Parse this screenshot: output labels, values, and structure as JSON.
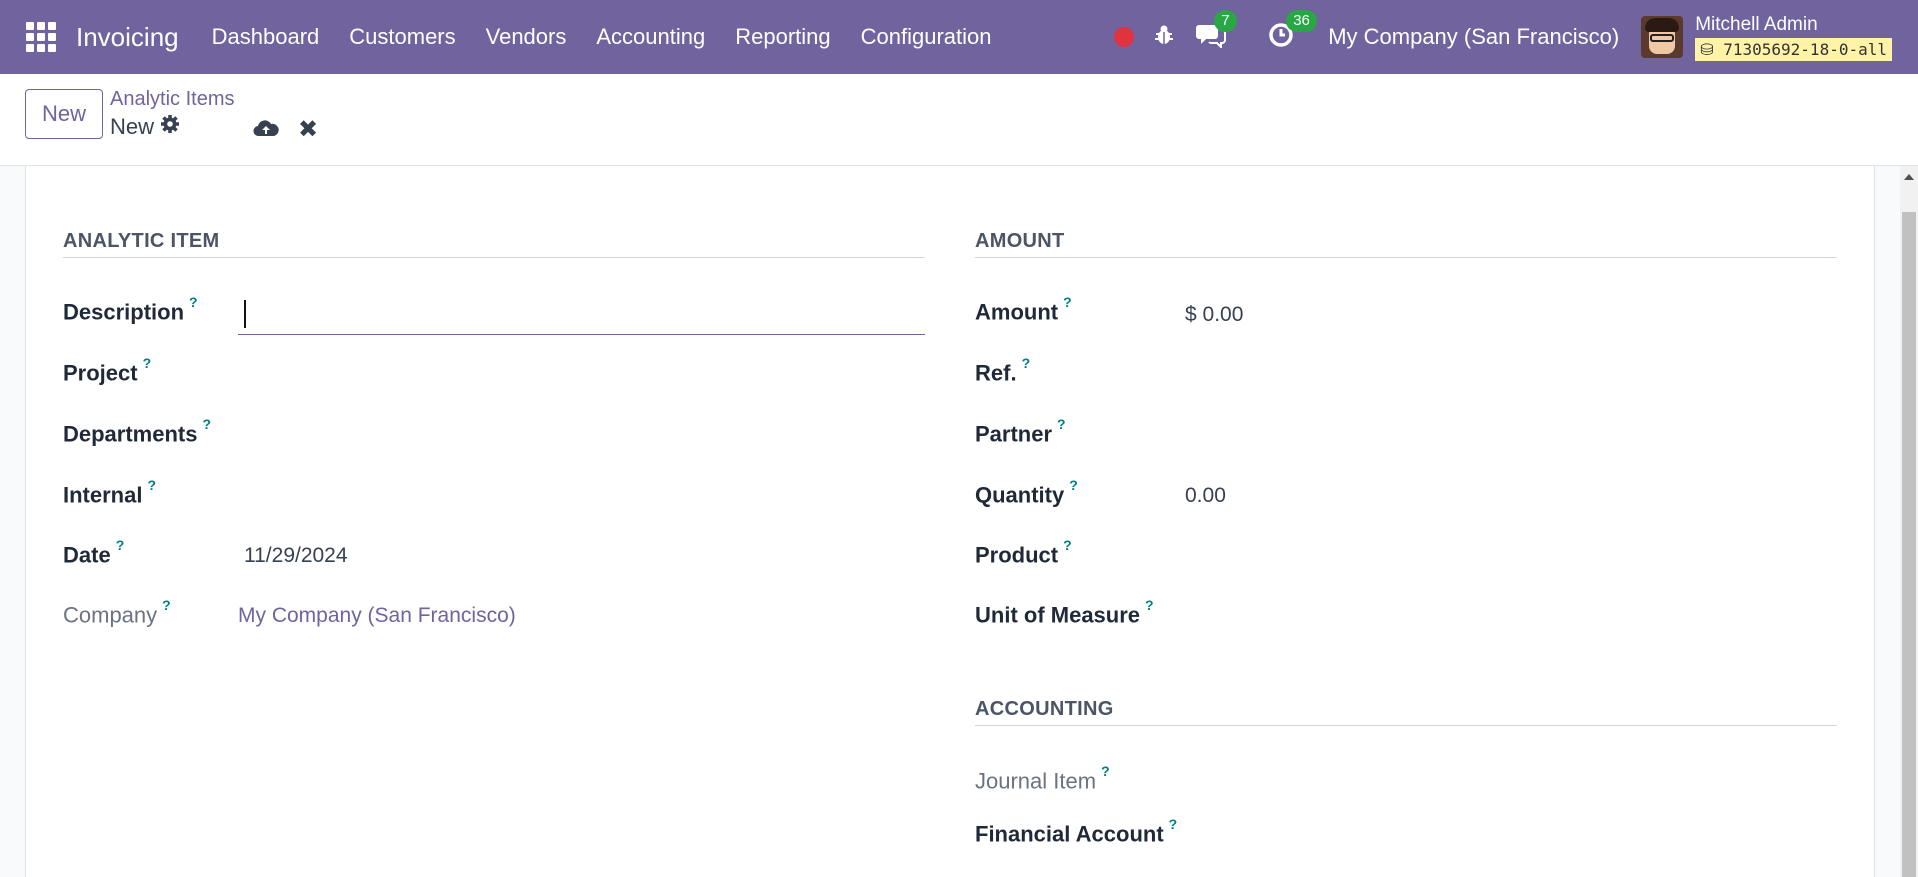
{
  "navbar": {
    "app_title": "Invoicing",
    "menu": [
      "Dashboard",
      "Customers",
      "Vendors",
      "Accounting",
      "Reporting",
      "Configuration"
    ],
    "chat_count": "7",
    "activity_count": "36",
    "company": "My Company (San Francisco)",
    "user_name": "Mitchell Admin",
    "database": "71305692-18-0-all",
    "accent_color": "#71639e"
  },
  "control": {
    "new_label": "New",
    "breadcrumb": "Analytic Items",
    "record_name": "New"
  },
  "form": {
    "left_section_title": "ANALYTIC ITEM",
    "right_section_title": "AMOUNT",
    "accounting_section_title": "ACCOUNTING",
    "help_marker": "?",
    "left_fields": {
      "description": {
        "label": "Description",
        "value": ""
      },
      "project": {
        "label": "Project",
        "value": ""
      },
      "departments": {
        "label": "Departments",
        "value": ""
      },
      "internal": {
        "label": "Internal",
        "value": ""
      },
      "date": {
        "label": "Date",
        "value": "11/29/2024"
      },
      "company": {
        "label": "Company",
        "value": "My Company (San Francisco)"
      }
    },
    "right_fields": {
      "amount": {
        "label": "Amount",
        "value": "$ 0.00"
      },
      "ref": {
        "label": "Ref.",
        "value": ""
      },
      "partner": {
        "label": "Partner",
        "value": ""
      },
      "quantity": {
        "label": "Quantity",
        "value": "0.00"
      },
      "product": {
        "label": "Product",
        "value": ""
      },
      "uom": {
        "label": "Unit of Measure",
        "value": ""
      }
    },
    "accounting_fields": {
      "journal_item": {
        "label": "Journal Item",
        "value": ""
      },
      "financial_account": {
        "label": "Financial Account",
        "value": ""
      }
    }
  }
}
